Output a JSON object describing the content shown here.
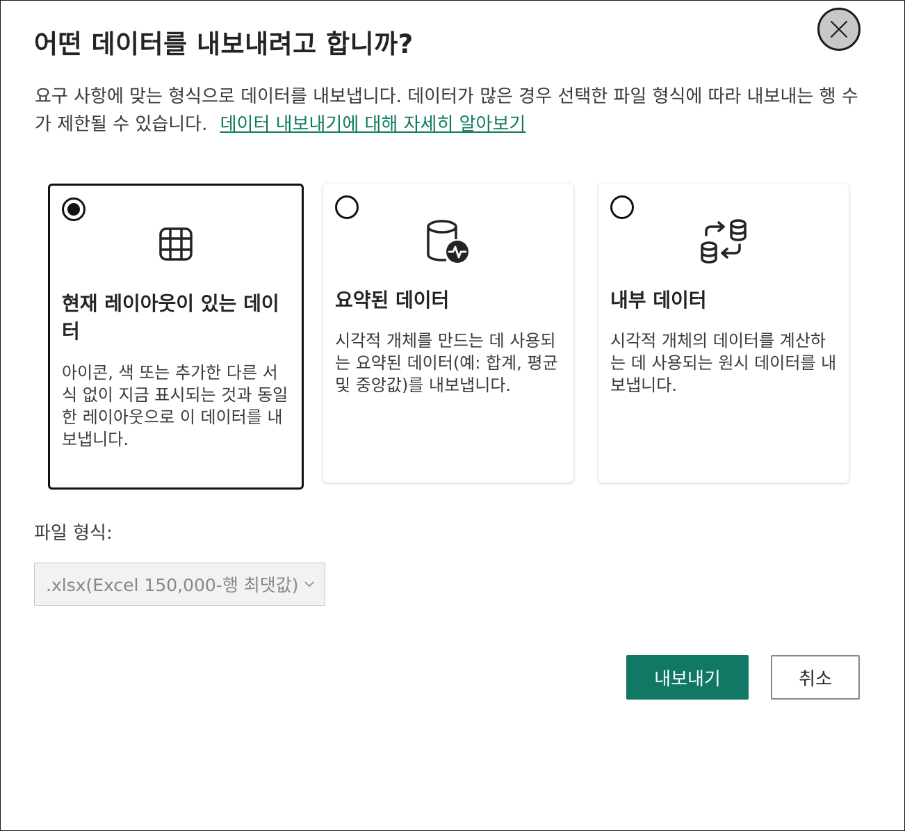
{
  "dialog": {
    "title": "어떤 데이터를 내보내려고 합니까?",
    "description": "요구 사항에 맞는 형식으로 데이터를 내보냅니다. 데이터가 많은 경우 선택한 파일 형식에 따라 내보내는 행 수가 제한될 수 있습니다.",
    "learn_more_link": "데이터 내보내기에 대해 자세히 알아보기",
    "close_icon": "close-icon"
  },
  "options": [
    {
      "title": "현재 레이아웃이 있는 데이터",
      "description": "아이콘, 색 또는 추가한 다른 서식 없이 지금 표시되는 것과 동일한 레이아웃으로 이 데이터를 내보냅니다.",
      "icon": "table-grid-icon",
      "selected": true
    },
    {
      "title": "요약된 데이터",
      "description": "시각적 개체를 만드는 데 사용되는 요약된 데이터(예: 합계, 평균 및 중앙값)를 내보냅니다.",
      "icon": "database-activity-icon",
      "selected": false
    },
    {
      "title": "내부 데이터",
      "description": "시각적 개체의 데이터를 계산하는 데 사용되는 원시 데이터를 내보냅니다.",
      "icon": "database-sync-icon",
      "selected": false
    }
  ],
  "file_format": {
    "label": "파일 형식:",
    "selected_value": ".xlsx(Excel 150,000-행 최댓값)",
    "disabled": true
  },
  "actions": {
    "export_label": "내보내기",
    "cancel_label": "취소"
  },
  "colors": {
    "accent": "#117865",
    "link": "#0e7a5f",
    "selected_border": "#111111"
  }
}
